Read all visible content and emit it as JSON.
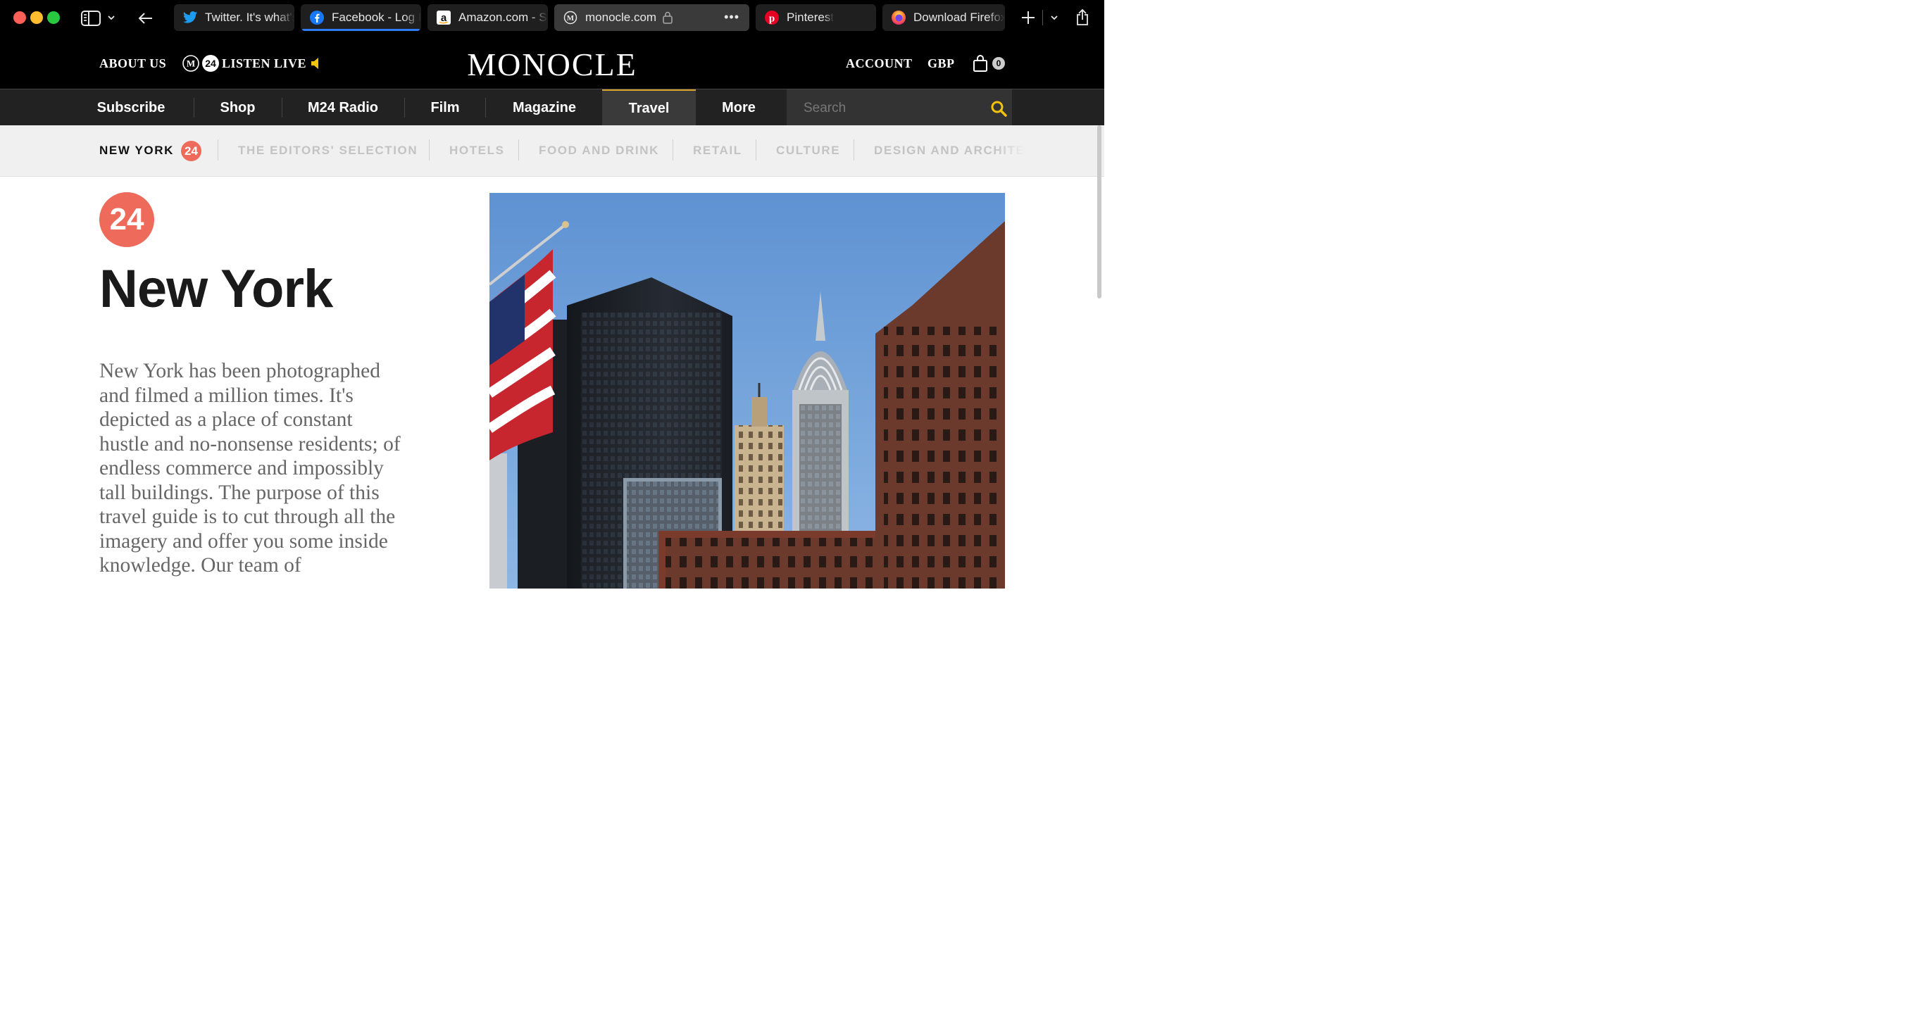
{
  "browser": {
    "tabs": [
      {
        "title": "Twitter. It's what's happening",
        "icon": "twitter-icon"
      },
      {
        "title": "Facebook - Log In or Sign Up",
        "icon": "facebook-icon"
      },
      {
        "title": "Amazon.com - Spend less",
        "icon": "amazon-icon"
      },
      {
        "title": "monocle.com",
        "icon": "monocle-icon"
      },
      {
        "title": "Pinterest",
        "icon": "pinterest-icon"
      },
      {
        "title": "Download Firefox",
        "icon": "firefox-icon"
      }
    ],
    "active_tab": 3
  },
  "header": {
    "about": "ABOUT US",
    "listen_badge": "24",
    "listen": "LISTEN LIVE",
    "logo": "MONOCLE",
    "account": "ACCOUNT",
    "currency": "GBP",
    "cart_count": "0"
  },
  "mainnav": {
    "items": [
      "Subscribe",
      "Shop",
      "M24 Radio",
      "Film",
      "Magazine",
      "Travel",
      "More"
    ],
    "active": "Travel",
    "search_placeholder": "Search"
  },
  "subnav": {
    "current": "NEW YORK",
    "badge": "24",
    "items": [
      "THE EDITORS' SELECTION",
      "HOTELS",
      "FOOD AND DRINK",
      "RETAIL",
      "CULTURE",
      "DESIGN AND ARCHITECTURE"
    ]
  },
  "content": {
    "badge": "24",
    "title": "New York",
    "intro": "New York has been photographed and filmed a million times. It's depicted as a place of constant hustle and no-nonsense residents; of endless commerce and impossibly tall buildings. The purpose of this travel guide is to cut through all the imagery and offer you some inside knowledge. Our team of"
  },
  "colors": {
    "accent_red": "#ee6b5b",
    "search_yellow": "#f2c20f",
    "travel_underline": "#d4a32a"
  }
}
